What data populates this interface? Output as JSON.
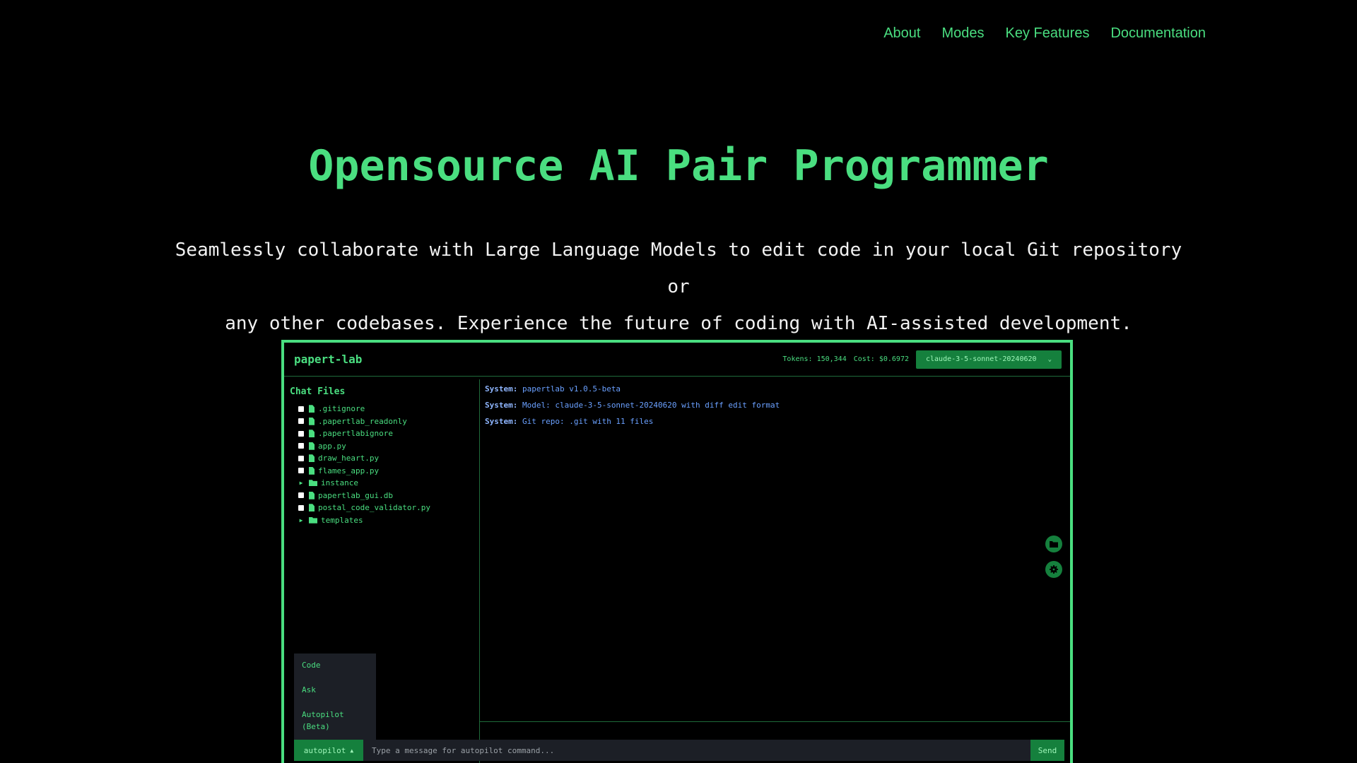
{
  "nav": {
    "items": [
      {
        "label": "About"
      },
      {
        "label": "Modes"
      },
      {
        "label": "Key Features"
      },
      {
        "label": "Documentation"
      }
    ]
  },
  "hero": {
    "title": "Opensource AI Pair Programmer",
    "subtitle_line1": "Seamlessly collaborate with Large Language Models to edit code in your local Git repository or",
    "subtitle_line2": "any other codebases. Experience the future of coding with AI-assisted development."
  },
  "app": {
    "title": "papert-lab",
    "tokens": "Tokens: 150,344",
    "cost": "Cost: $0.6972",
    "model": "claude-3-5-sonnet-20240620",
    "sidebar_title": "Chat Files",
    "files": [
      {
        "name": ".gitignore",
        "type": "file"
      },
      {
        "name": ".papertlab_readonly",
        "type": "file"
      },
      {
        "name": ".papertlabignore",
        "type": "file"
      },
      {
        "name": "app.py",
        "type": "file"
      },
      {
        "name": "draw_heart.py",
        "type": "file"
      },
      {
        "name": "flames_app.py",
        "type": "file"
      },
      {
        "name": "instance",
        "type": "folder"
      },
      {
        "name": "papertlab_gui.db",
        "type": "file"
      },
      {
        "name": "postal_code_validator.py",
        "type": "file"
      },
      {
        "name": "templates",
        "type": "folder"
      }
    ],
    "messages": [
      {
        "prefix": "System:",
        "text": "papertlab v1.0.5-beta"
      },
      {
        "prefix": "System:",
        "text": "Model: claude-3-5-sonnet-20240620 with diff edit format"
      },
      {
        "prefix": "System:",
        "text": "Git repo: .git with 11 files"
      }
    ],
    "mode_menu": {
      "code": "Code",
      "ask": "Ask",
      "autopilot_1": "Autopilot",
      "autopilot_2": "(Beta)"
    },
    "mode_button": "autopilot",
    "input_placeholder": "Type a message for autopilot command...",
    "send_label": "Send",
    "side_icons": [
      "folder-icon",
      "gear-icon"
    ]
  },
  "colors": {
    "accent": "#4ade80",
    "button": "#15803d",
    "message": "#6aa0ff",
    "background": "#000000"
  }
}
